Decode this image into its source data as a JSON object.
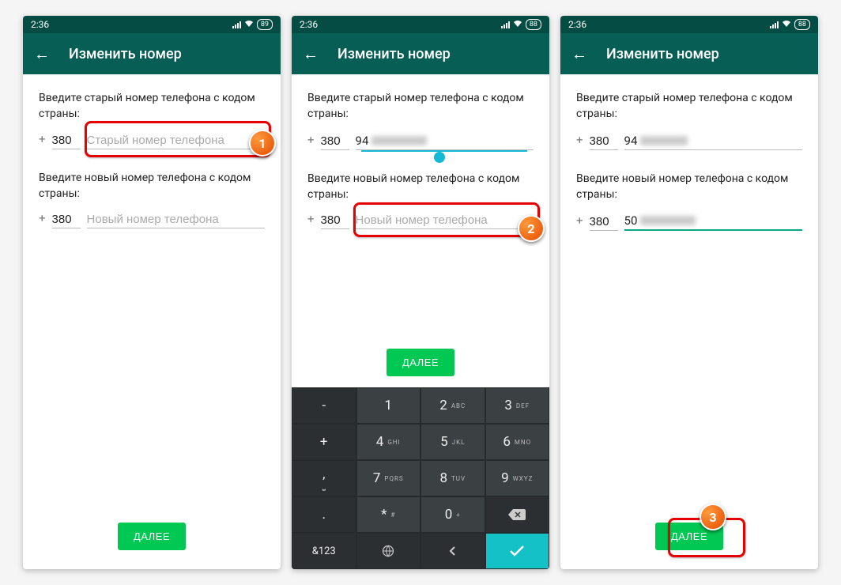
{
  "status": {
    "time": "2:36",
    "battery": [
      "89",
      "88",
      "88"
    ]
  },
  "appbar": {
    "title": "Изменить номер"
  },
  "labels": {
    "old": "Введите старый номер телефона с кодом страны:",
    "new": "Введите новый номер телефона с кодом страны:"
  },
  "placeholders": {
    "old": "Старый номер телефона",
    "new": "Новый номер телефона"
  },
  "cc": "380",
  "plus": "+",
  "button": "ДАЛЕЕ",
  "badges": [
    "1",
    "2",
    "3"
  ],
  "screen2": {
    "old_prefix": "94"
  },
  "screen3": {
    "old_prefix": "94",
    "new_prefix": "50"
  },
  "keypad": {
    "rows": [
      [
        {
          "k": "-",
          "d": true
        },
        {
          "k": "1",
          "s": ""
        },
        {
          "k": "2",
          "s": "ABC"
        },
        {
          "k": "3",
          "s": "DEF"
        }
      ],
      [
        {
          "k": "+",
          "d": true
        },
        {
          "k": "4",
          "s": "GHI"
        },
        {
          "k": "5",
          "s": "JKL"
        },
        {
          "k": "6",
          "s": "MNO"
        }
      ],
      [
        {
          "k": ",",
          "d": true
        },
        {
          "k": "7",
          "s": "PQRS"
        },
        {
          "k": "8",
          "s": "TUV"
        },
        {
          "k": "9",
          "s": "WXYZ"
        }
      ],
      [
        {
          "k": ".",
          "d": true
        },
        {
          "k": "*",
          "s": "#"
        },
        {
          "k": "0",
          "s": "+"
        },
        {
          "k": "del",
          "d": true
        }
      ]
    ],
    "done": "✓"
  }
}
